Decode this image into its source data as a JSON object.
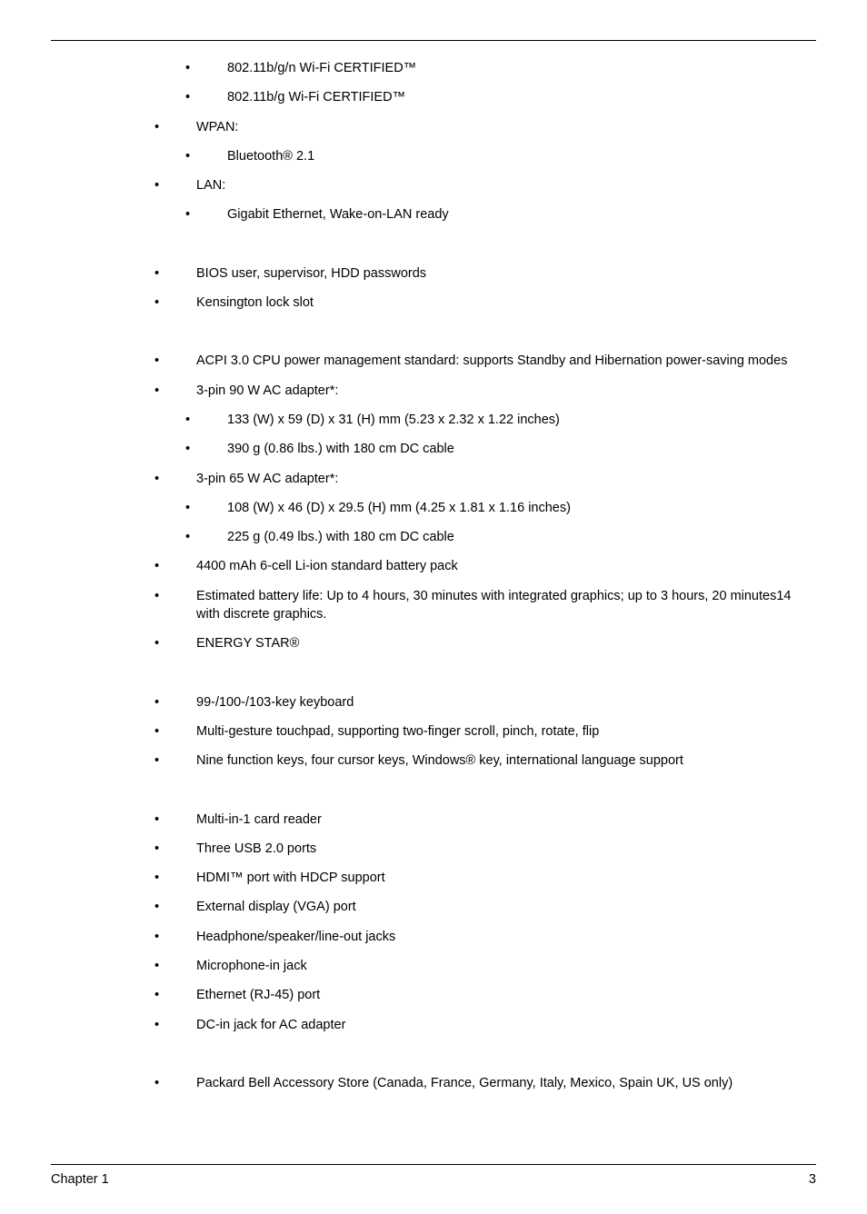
{
  "sections": [
    {
      "items": [
        {
          "sub": [
            {
              "text": "802.11b/g/n Wi-Fi CERTIFIED™"
            },
            {
              "text": "802.11b/g Wi-Fi CERTIFIED™"
            }
          ]
        },
        {
          "text": "WPAN:",
          "sub": [
            {
              "text": "Bluetooth® 2.1"
            }
          ]
        },
        {
          "text": "LAN:",
          "sub": [
            {
              "text": "Gigabit Ethernet, Wake-on-LAN ready"
            }
          ]
        }
      ]
    },
    {
      "items": [
        {
          "text": "BIOS user, supervisor, HDD passwords"
        },
        {
          "text": "Kensington lock slot"
        }
      ]
    },
    {
      "items": [
        {
          "text": "ACPI 3.0 CPU power management standard: supports Standby and Hibernation power-saving modes"
        },
        {
          "text": "3-pin 90 W AC adapter*:",
          "sub": [
            {
              "text": "133 (W) x 59 (D) x 31 (H) mm (5.23 x 2.32 x 1.22 inches)"
            },
            {
              "text": "390 g (0.86 lbs.) with 180 cm DC cable"
            }
          ]
        },
        {
          "text": "3-pin 65 W AC adapter*:",
          "sub": [
            {
              "text": "108 (W) x 46 (D) x 29.5 (H) mm (4.25 x 1.81 x 1.16 inches)"
            },
            {
              "text": "225 g (0.49 lbs.) with 180 cm DC cable"
            }
          ]
        },
        {
          "text": "4400 mAh 6-cell Li-ion standard battery pack"
        },
        {
          "text": "Estimated battery life: Up to 4 hours, 30 minutes with integrated graphics; up to 3 hours, 20 minutes14 with discrete graphics."
        },
        {
          "text": "ENERGY STAR®"
        }
      ]
    },
    {
      "items": [
        {
          "text": "99-/100-/103-key keyboard"
        },
        {
          "text": "Multi-gesture touchpad, supporting two-finger scroll, pinch, rotate, flip"
        },
        {
          "text": "Nine function keys, four cursor keys, Windows® key, international language support"
        }
      ]
    },
    {
      "items": [
        {
          "text": "Multi-in-1 card reader"
        },
        {
          "text": "Three USB 2.0 ports"
        },
        {
          "text": "HDMI™ port with HDCP support"
        },
        {
          "text": "External display (VGA) port"
        },
        {
          "text": "Headphone/speaker/line-out jacks"
        },
        {
          "text": "Microphone-in jack"
        },
        {
          "text": "Ethernet (RJ-45) port"
        },
        {
          "text": "DC-in jack for AC adapter"
        }
      ]
    },
    {
      "items": [
        {
          "text": "Packard Bell Accessory Store (Canada, France, Germany, Italy, Mexico, Spain UK, US only)"
        }
      ]
    }
  ],
  "footer": {
    "left": "Chapter 1",
    "right": "3"
  }
}
